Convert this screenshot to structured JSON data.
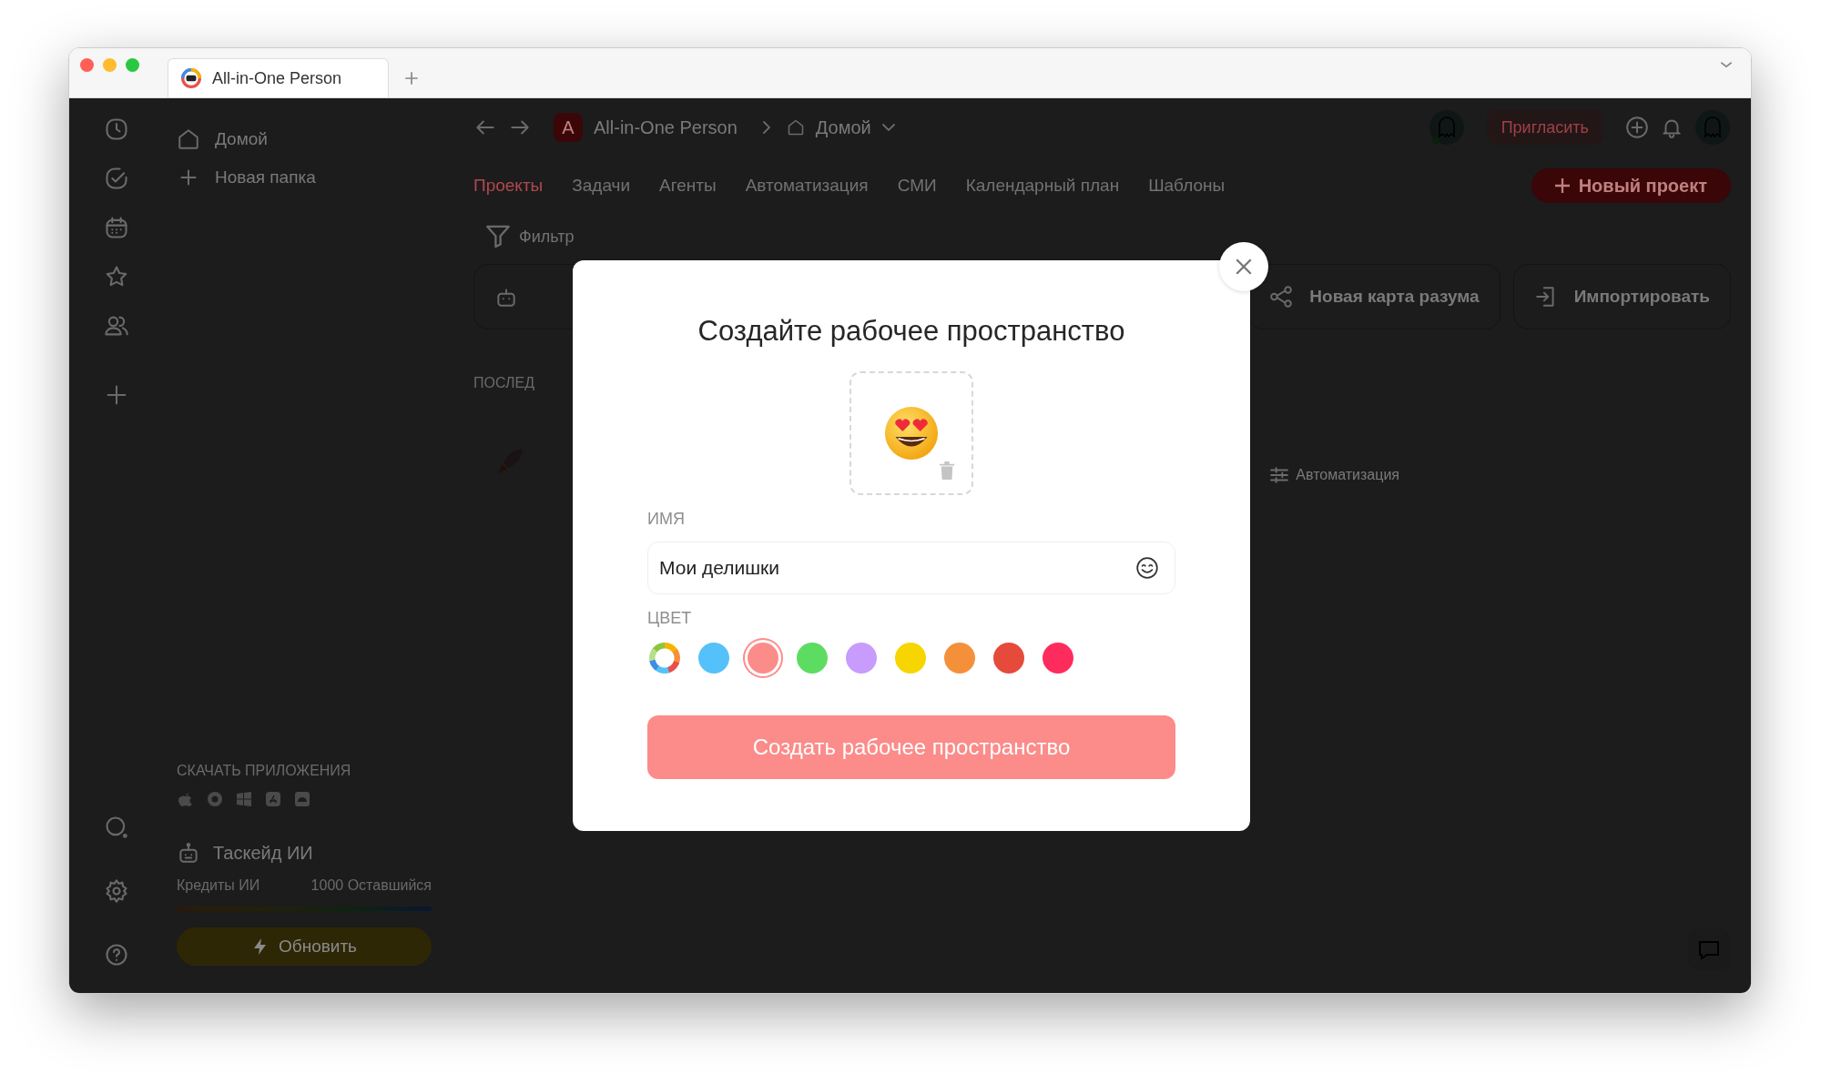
{
  "browser": {
    "tabs": [
      {
        "title": "All-in-One Person",
        "selected": true
      }
    ]
  },
  "sidebar": {
    "items": [
      {
        "kind": "home",
        "label": "Домой"
      },
      {
        "kind": "add",
        "label": "Новая папка"
      }
    ],
    "downloads_heading": "СКАЧАТЬ ПРИЛОЖЕНИЯ",
    "ai_title": "Таскейд ИИ",
    "credits_label": "Кредиты ИИ",
    "credits_remaining": "1000 Оставшийся",
    "upgrade_button": "Обновить"
  },
  "header": {
    "workspace_initial": "A",
    "workspace": "All-in-One Person",
    "location": "Домой",
    "invite": "Пригласить",
    "new_project": "Новый проект"
  },
  "tabs": [
    {
      "label": "Проекты",
      "selected": true
    },
    {
      "label": "Задачи",
      "selected": false
    },
    {
      "label": "Агенты",
      "selected": false
    },
    {
      "label": "Автоматизация",
      "selected": false
    },
    {
      "label": "СМИ",
      "selected": false
    },
    {
      "label": "Календарный план",
      "selected": false
    },
    {
      "label": "Шаблоны",
      "selected": false
    }
  ],
  "filter": "Фильтр",
  "actions": [
    {
      "kind": "mindmap",
      "label": "Новая карта разума"
    },
    {
      "kind": "import",
      "label": "Импортировать"
    }
  ],
  "recent": {
    "heading": "ПОСЛЕД",
    "tag": "Автоматизация"
  },
  "modal": {
    "title": "Создайте рабочее пространство",
    "name_label": "ИМЯ",
    "name_value": "Мои делишки",
    "color_label": "ЦВЕТ",
    "colors": [
      {
        "kind": "custom",
        "selected": false
      },
      {
        "kind": "solid",
        "color": "#55c1fa",
        "selected": false
      },
      {
        "kind": "solid",
        "color": "#fb8c8a",
        "selected": true
      },
      {
        "kind": "solid",
        "color": "#5ddc62",
        "selected": false
      },
      {
        "kind": "solid",
        "color": "#c79cfc",
        "selected": false
      },
      {
        "kind": "solid",
        "color": "#f7d500",
        "selected": false
      },
      {
        "kind": "solid",
        "color": "#f5903a",
        "selected": false
      },
      {
        "kind": "solid",
        "color": "#e64a3b",
        "selected": false
      },
      {
        "kind": "solid",
        "color": "#fe2c5c",
        "selected": false
      }
    ],
    "submit": "Создать рабочее пространство"
  }
}
